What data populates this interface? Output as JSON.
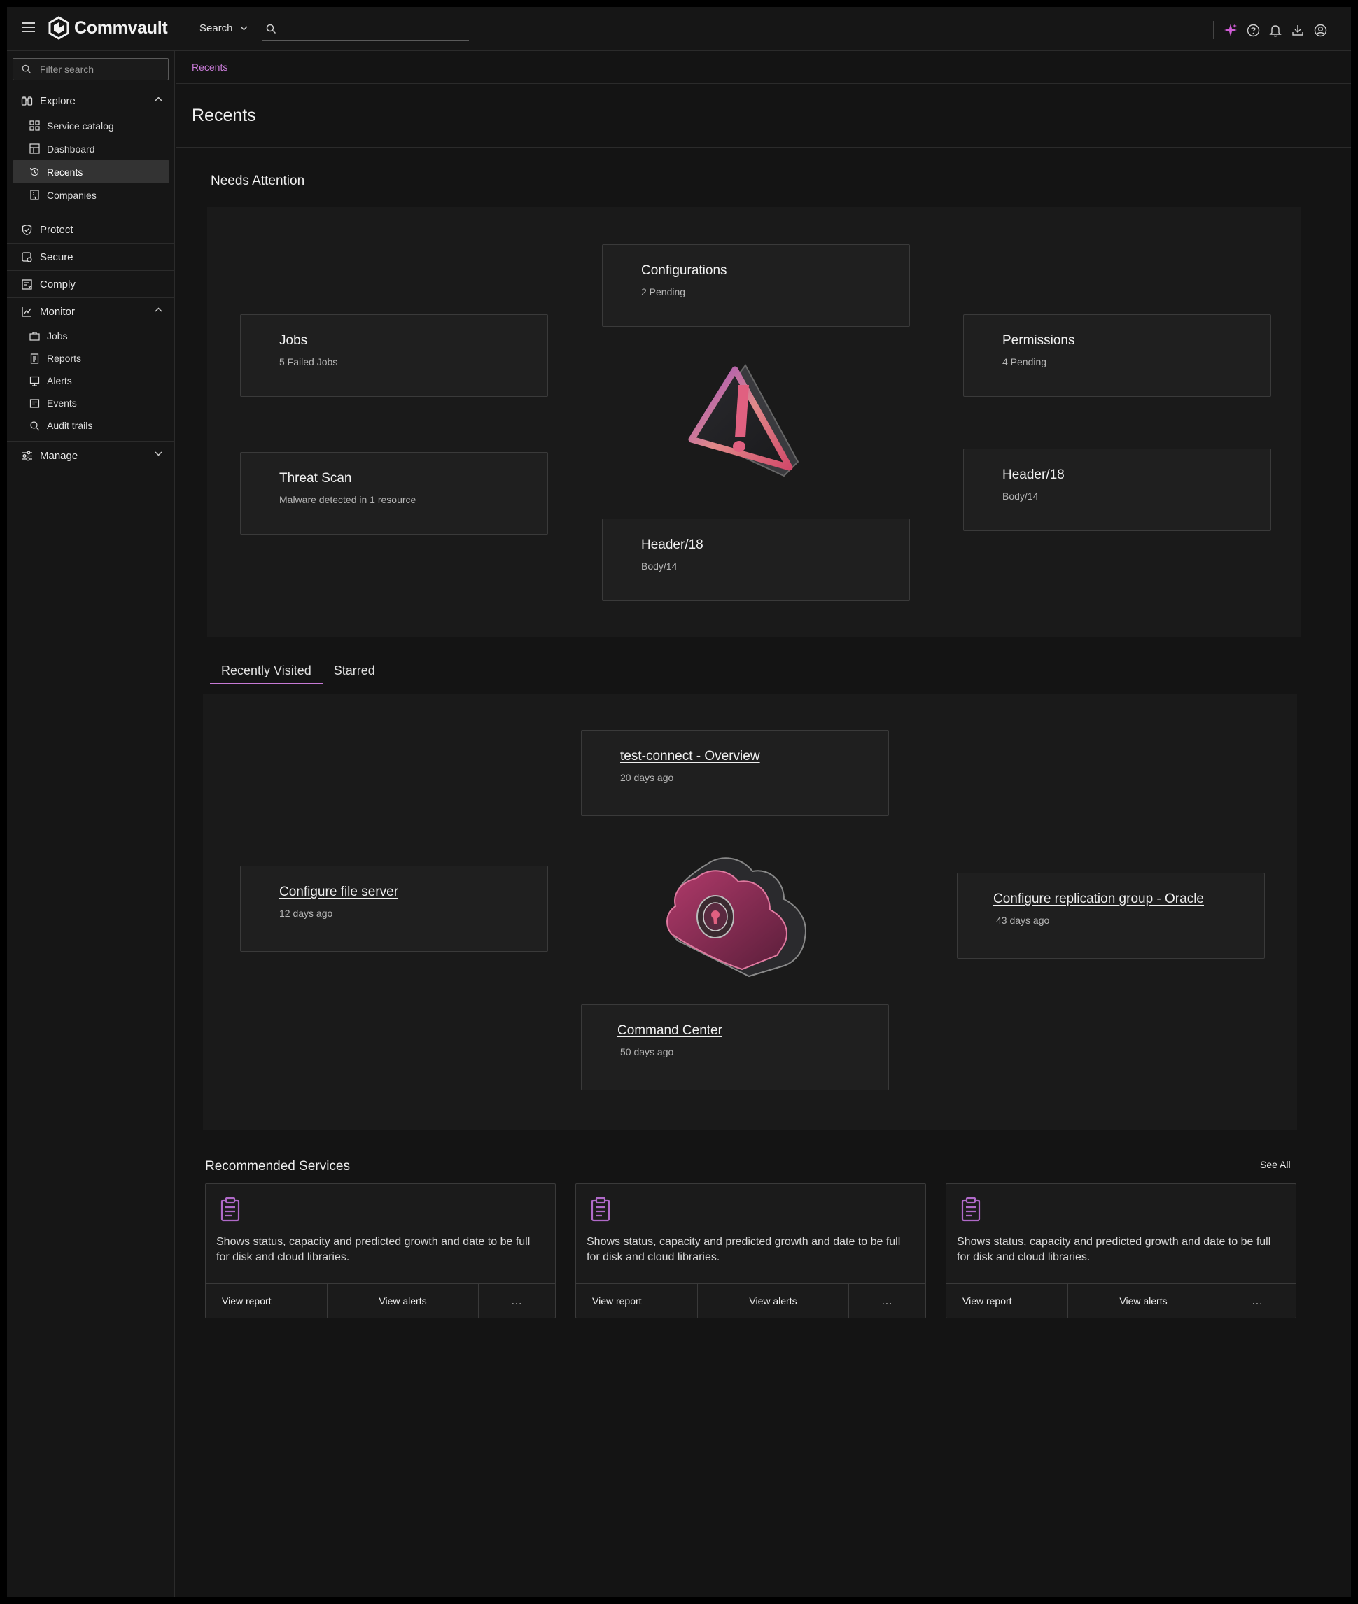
{
  "topbar": {
    "brand": "Commvault",
    "search_scope": "Search",
    "search_placeholder": ""
  },
  "sidebar": {
    "filter_placeholder": "Filter search",
    "explore": {
      "label": "Explore",
      "items": [
        {
          "label": "Service catalog",
          "icon": "grid-icon"
        },
        {
          "label": "Dashboard",
          "icon": "dashboard-icon"
        },
        {
          "label": "Recents",
          "icon": "history-icon"
        },
        {
          "label": "Companies",
          "icon": "building-icon"
        }
      ]
    },
    "protect": "Protect",
    "secure": "Secure",
    "comply": "Comply",
    "monitor": {
      "label": "Monitor",
      "items": [
        {
          "label": "Jobs",
          "icon": "briefcase-icon"
        },
        {
          "label": "Reports",
          "icon": "report-icon"
        },
        {
          "label": "Alerts",
          "icon": "alert-icon"
        },
        {
          "label": "Events",
          "icon": "event-icon"
        },
        {
          "label": "Audit trails",
          "icon": "audit-icon"
        }
      ]
    },
    "manage": "Manage"
  },
  "breadcrumb": "Recents",
  "page_title": "Recents",
  "needs_attention": {
    "title": "Needs Attention",
    "cards": [
      {
        "header": "Configurations",
        "body": "2 Pending"
      },
      {
        "header": "Jobs",
        "body": "5 Failed Jobs"
      },
      {
        "header": "Permissions",
        "body": "4 Pending"
      },
      {
        "header": "Threat Scan",
        "body": "Malware detected in 1 resource"
      },
      {
        "header": "Header/18",
        "body": "Body/14"
      },
      {
        "header": "Header/18",
        "body": "Body/14"
      }
    ]
  },
  "tabs": [
    "Recently Visited",
    "Starred"
  ],
  "recent": {
    "cards": [
      {
        "header": "test-connect - Overview",
        "body": "20 days ago"
      },
      {
        "header": "Configure file server",
        "body": "12 days ago"
      },
      {
        "header": "Configure replication group - Oracle",
        "body": "43 days ago"
      },
      {
        "header": "Command Center",
        "body": "50 days ago"
      }
    ]
  },
  "recommended": {
    "title": "Recommended Services",
    "see_all": "See All",
    "services": [
      {
        "description": "Shows status, capacity and predicted growth and date to be full for disk and cloud libraries.",
        "view_report": "View report",
        "view_alerts": "View alerts",
        "more": "..."
      },
      {
        "description": "Shows status, capacity and predicted growth and date to be full for disk and cloud libraries.",
        "view_report": "View report",
        "view_alerts": "View alerts",
        "more": "..."
      },
      {
        "description": "Shows status, capacity and predicted growth and date to be full for disk and cloud libraries.",
        "view_report": "View report",
        "view_alerts": "View alerts",
        "more": "..."
      }
    ]
  },
  "colors": {
    "accent": "#c77ad6",
    "background": "#141414",
    "card": "#1f1f1f"
  }
}
